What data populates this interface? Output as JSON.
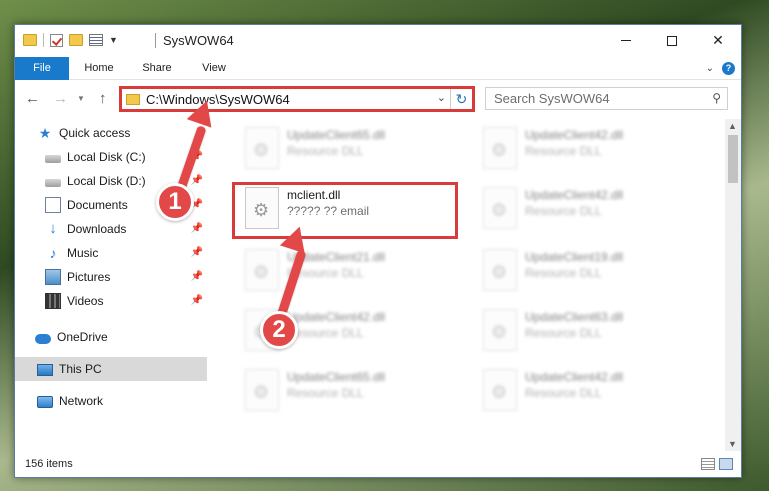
{
  "window": {
    "title": "SysWOW64"
  },
  "ribbon": {
    "tabs": [
      "File",
      "Home",
      "Share",
      "View"
    ]
  },
  "address": {
    "path": "C:\\Windows\\SysWOW64"
  },
  "search": {
    "placeholder": "Search SysWOW64"
  },
  "nav_pane": {
    "items": [
      {
        "label": "Quick access",
        "icon": "star-icon",
        "pinned": false
      },
      {
        "label": "Local Disk (C:)",
        "icon": "drive-icon",
        "pinned": true
      },
      {
        "label": "Local Disk (D:)",
        "icon": "drive-icon",
        "pinned": true
      },
      {
        "label": "Documents",
        "icon": "document-icon",
        "pinned": true
      },
      {
        "label": "Downloads",
        "icon": "download-icon",
        "pinned": true
      },
      {
        "label": "Music",
        "icon": "music-icon",
        "pinned": true
      },
      {
        "label": "Pictures",
        "icon": "picture-icon",
        "pinned": true
      },
      {
        "label": "Videos",
        "icon": "video-icon",
        "pinned": true
      },
      {
        "label": "OneDrive",
        "icon": "cloud-icon",
        "pinned": false
      },
      {
        "label": "This PC",
        "icon": "computer-icon",
        "pinned": false,
        "selected": true
      },
      {
        "label": "Network",
        "icon": "network-icon",
        "pinned": false
      }
    ]
  },
  "files": [
    {
      "name": "UpdateClient65.dll",
      "desc": "Resource DLL",
      "blurred": true
    },
    {
      "name": "UpdateClient42.dll",
      "desc": "Resource DLL",
      "blurred": true
    },
    {
      "name": "mclient.dll",
      "desc": "????? ?? email",
      "blurred": false,
      "highlighted": true
    },
    {
      "name": "UpdateClient42.dll",
      "desc": "Resource DLL",
      "blurred": true
    },
    {
      "name": "UpdateClient21.dll",
      "desc": "Resource DLL",
      "blurred": true
    },
    {
      "name": "UpdateClient19.dll",
      "desc": "Resource DLL",
      "blurred": true
    },
    {
      "name": "UpdateClient42.dll",
      "desc": "Resource DLL",
      "blurred": true
    },
    {
      "name": "UpdateClient63.dll",
      "desc": "Resource DLL",
      "blurred": true
    },
    {
      "name": "UpdateClient65.dll",
      "desc": "Resource DLL",
      "blurred": true
    },
    {
      "name": "UpdateClient42.dll",
      "desc": "Resource DLL",
      "blurred": true
    }
  ],
  "status": {
    "item_count": "156 items"
  },
  "annotations": {
    "step1": "1",
    "step2": "2"
  },
  "colors": {
    "accent": "#1979ca",
    "annotation_red": "#e34848",
    "selection": "#d9d9d9"
  }
}
